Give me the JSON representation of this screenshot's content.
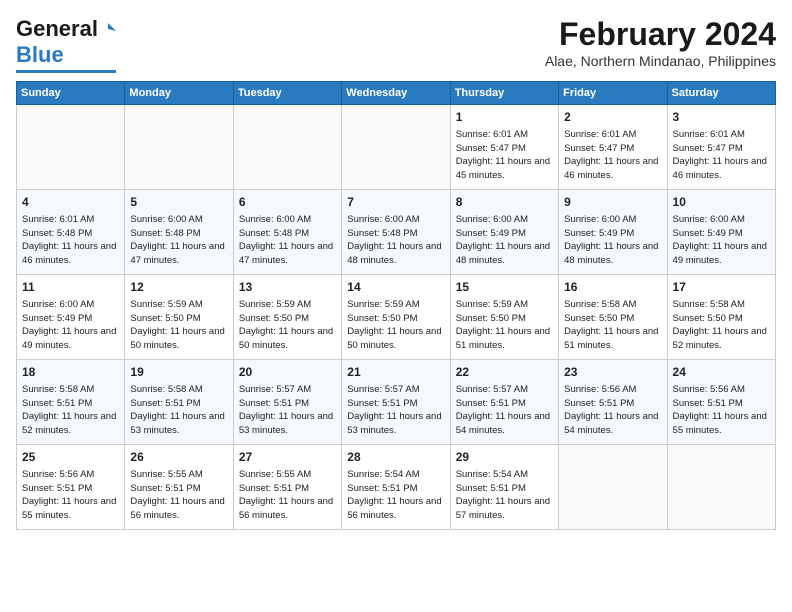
{
  "logo": {
    "general": "General",
    "blue": "Blue"
  },
  "title": "February 2024",
  "location": "Alae, Northern Mindanao, Philippines",
  "days_header": [
    "Sunday",
    "Monday",
    "Tuesday",
    "Wednesday",
    "Thursday",
    "Friday",
    "Saturday"
  ],
  "weeks": [
    [
      {
        "num": "",
        "info": ""
      },
      {
        "num": "",
        "info": ""
      },
      {
        "num": "",
        "info": ""
      },
      {
        "num": "",
        "info": ""
      },
      {
        "num": "1",
        "info": "Sunrise: 6:01 AM\nSunset: 5:47 PM\nDaylight: 11 hours and 45 minutes."
      },
      {
        "num": "2",
        "info": "Sunrise: 6:01 AM\nSunset: 5:47 PM\nDaylight: 11 hours and 46 minutes."
      },
      {
        "num": "3",
        "info": "Sunrise: 6:01 AM\nSunset: 5:47 PM\nDaylight: 11 hours and 46 minutes."
      }
    ],
    [
      {
        "num": "4",
        "info": "Sunrise: 6:01 AM\nSunset: 5:48 PM\nDaylight: 11 hours and 46 minutes."
      },
      {
        "num": "5",
        "info": "Sunrise: 6:00 AM\nSunset: 5:48 PM\nDaylight: 11 hours and 47 minutes."
      },
      {
        "num": "6",
        "info": "Sunrise: 6:00 AM\nSunset: 5:48 PM\nDaylight: 11 hours and 47 minutes."
      },
      {
        "num": "7",
        "info": "Sunrise: 6:00 AM\nSunset: 5:48 PM\nDaylight: 11 hours and 48 minutes."
      },
      {
        "num": "8",
        "info": "Sunrise: 6:00 AM\nSunset: 5:49 PM\nDaylight: 11 hours and 48 minutes."
      },
      {
        "num": "9",
        "info": "Sunrise: 6:00 AM\nSunset: 5:49 PM\nDaylight: 11 hours and 48 minutes."
      },
      {
        "num": "10",
        "info": "Sunrise: 6:00 AM\nSunset: 5:49 PM\nDaylight: 11 hours and 49 minutes."
      }
    ],
    [
      {
        "num": "11",
        "info": "Sunrise: 6:00 AM\nSunset: 5:49 PM\nDaylight: 11 hours and 49 minutes."
      },
      {
        "num": "12",
        "info": "Sunrise: 5:59 AM\nSunset: 5:50 PM\nDaylight: 11 hours and 50 minutes."
      },
      {
        "num": "13",
        "info": "Sunrise: 5:59 AM\nSunset: 5:50 PM\nDaylight: 11 hours and 50 minutes."
      },
      {
        "num": "14",
        "info": "Sunrise: 5:59 AM\nSunset: 5:50 PM\nDaylight: 11 hours and 50 minutes."
      },
      {
        "num": "15",
        "info": "Sunrise: 5:59 AM\nSunset: 5:50 PM\nDaylight: 11 hours and 51 minutes."
      },
      {
        "num": "16",
        "info": "Sunrise: 5:58 AM\nSunset: 5:50 PM\nDaylight: 11 hours and 51 minutes."
      },
      {
        "num": "17",
        "info": "Sunrise: 5:58 AM\nSunset: 5:50 PM\nDaylight: 11 hours and 52 minutes."
      }
    ],
    [
      {
        "num": "18",
        "info": "Sunrise: 5:58 AM\nSunset: 5:51 PM\nDaylight: 11 hours and 52 minutes."
      },
      {
        "num": "19",
        "info": "Sunrise: 5:58 AM\nSunset: 5:51 PM\nDaylight: 11 hours and 53 minutes."
      },
      {
        "num": "20",
        "info": "Sunrise: 5:57 AM\nSunset: 5:51 PM\nDaylight: 11 hours and 53 minutes."
      },
      {
        "num": "21",
        "info": "Sunrise: 5:57 AM\nSunset: 5:51 PM\nDaylight: 11 hours and 53 minutes."
      },
      {
        "num": "22",
        "info": "Sunrise: 5:57 AM\nSunset: 5:51 PM\nDaylight: 11 hours and 54 minutes."
      },
      {
        "num": "23",
        "info": "Sunrise: 5:56 AM\nSunset: 5:51 PM\nDaylight: 11 hours and 54 minutes."
      },
      {
        "num": "24",
        "info": "Sunrise: 5:56 AM\nSunset: 5:51 PM\nDaylight: 11 hours and 55 minutes."
      }
    ],
    [
      {
        "num": "25",
        "info": "Sunrise: 5:56 AM\nSunset: 5:51 PM\nDaylight: 11 hours and 55 minutes."
      },
      {
        "num": "26",
        "info": "Sunrise: 5:55 AM\nSunset: 5:51 PM\nDaylight: 11 hours and 56 minutes."
      },
      {
        "num": "27",
        "info": "Sunrise: 5:55 AM\nSunset: 5:51 PM\nDaylight: 11 hours and 56 minutes."
      },
      {
        "num": "28",
        "info": "Sunrise: 5:54 AM\nSunset: 5:51 PM\nDaylight: 11 hours and 56 minutes."
      },
      {
        "num": "29",
        "info": "Sunrise: 5:54 AM\nSunset: 5:51 PM\nDaylight: 11 hours and 57 minutes."
      },
      {
        "num": "",
        "info": ""
      },
      {
        "num": "",
        "info": ""
      }
    ]
  ]
}
